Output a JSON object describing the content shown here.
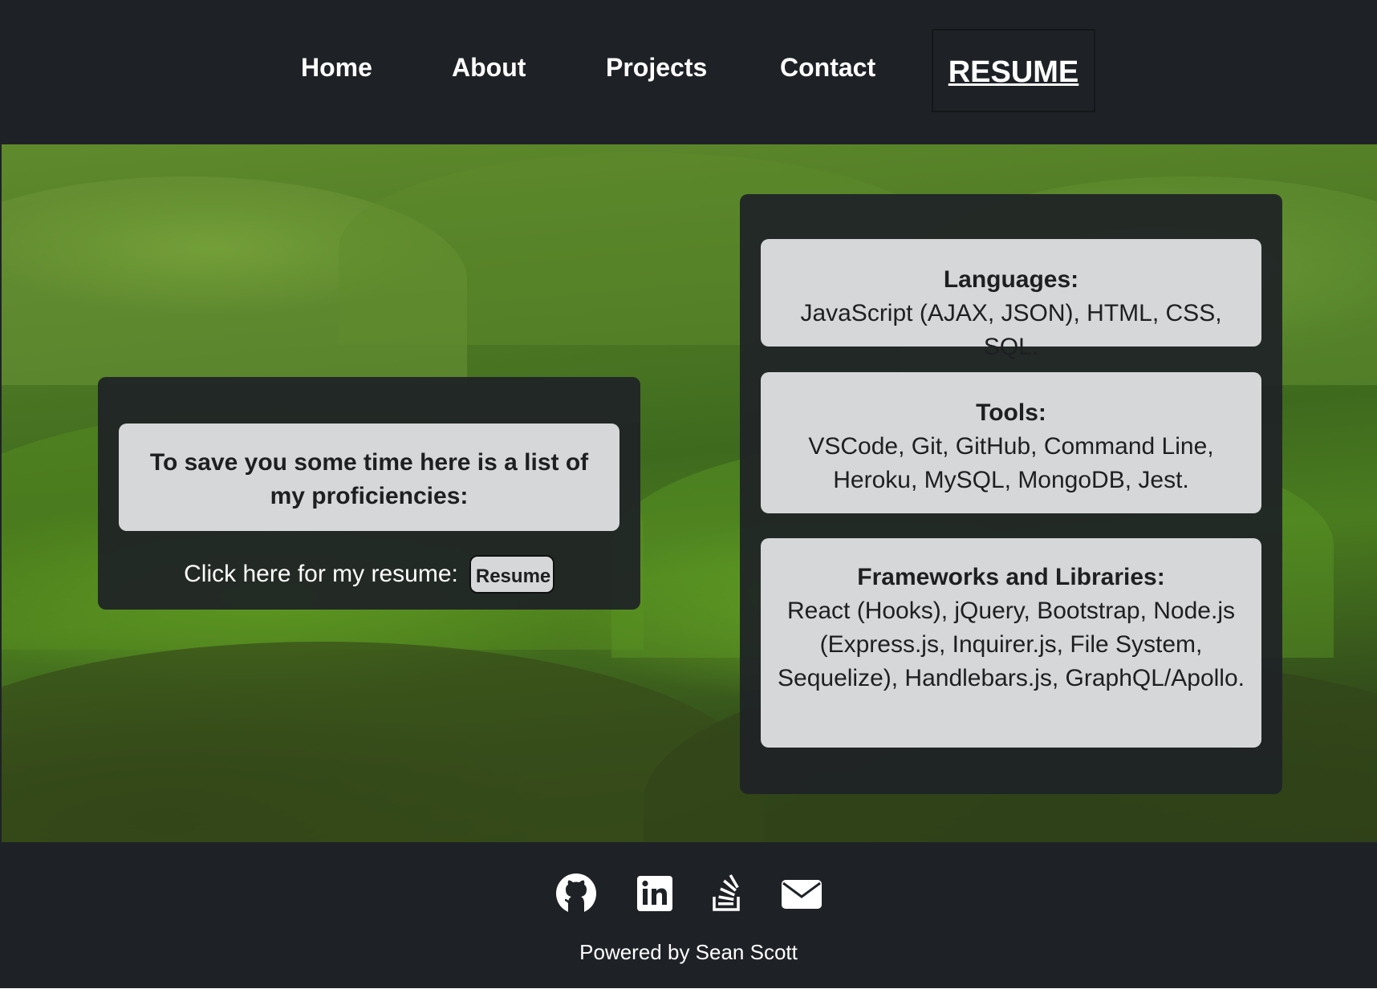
{
  "nav": {
    "home": "Home",
    "about": "About",
    "projects": "Projects",
    "contact": "Contact",
    "resume": "RESUME"
  },
  "intro": {
    "text": "To save you some time here is a list of my proficiencies:",
    "resume_label": "Click here for my resume:",
    "resume_button": "Resume"
  },
  "skills": [
    {
      "title": "Languages:",
      "text": "JavaScript (AJAX, JSON), HTML, CSS, SQL."
    },
    {
      "title": "Tools:",
      "text": "VSCode, Git, GitHub, Command Line, Heroku, MySQL, MongoDB, Jest."
    },
    {
      "title": "Frameworks and Libraries:",
      "text": "React (Hooks), jQuery, Bootstrap, Node.js (Express.js, Inquirer.js, File System, Sequelize), Handlebars.js, GraphQL/Apollo."
    }
  ],
  "footer": {
    "icons": [
      "github-icon",
      "linkedin-icon",
      "stack-overflow-icon",
      "email-icon"
    ],
    "powered_by": "Powered by Sean Scott"
  },
  "colors": {
    "background": "#1e2226",
    "card": "#d6d7d8",
    "text_light": "#ffffff",
    "text_dark": "#1d1f21"
  }
}
